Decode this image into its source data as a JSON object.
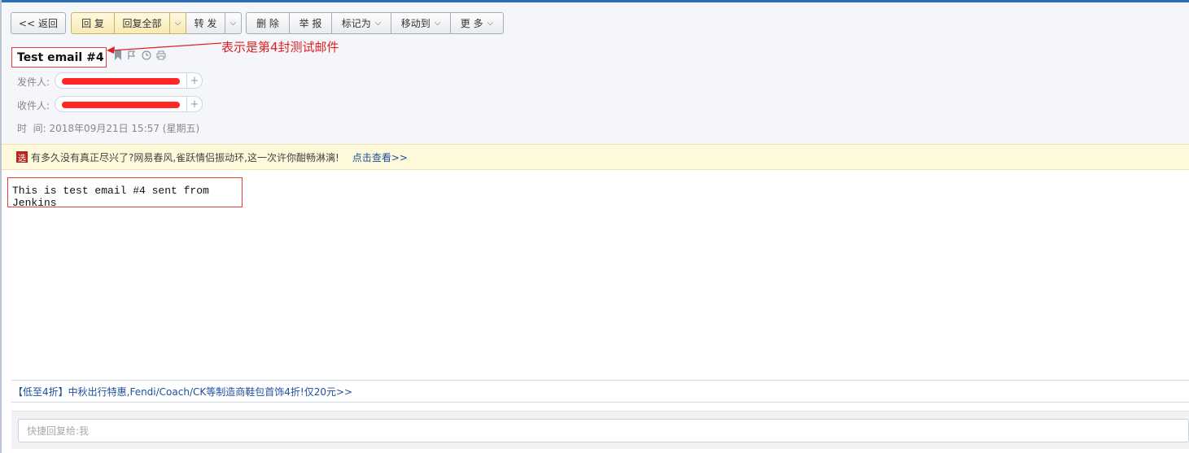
{
  "toolbar": {
    "back": "<< 返回",
    "reply": "回 复",
    "reply_all": "回复全部",
    "forward": "转 发",
    "delete": "删 除",
    "report": "举 报",
    "mark_as": "标记为",
    "move_to": "移动到",
    "more": "更 多"
  },
  "email": {
    "subject": "Test email #4",
    "annotation": "表示是第4封测试邮件",
    "sender_label": "发件人:",
    "recipient_label": "收件人:",
    "time_label": "时  间:",
    "time_value": "2018年09月21日 15:57 (星期五)",
    "body": "This is test email #4 sent from Jenkins"
  },
  "promo": {
    "icon_char": "选",
    "text": "有多久没有真正尽兴了?网易春风,雀跃情侣振动环,这一次许你酣畅淋漓!",
    "link": "点击查看>>"
  },
  "footer_ad": {
    "text": "【低至4折】中秋出行特惠,Fendi/Coach/CK等制造商鞋包首饰4折!仅20元>>"
  },
  "quick_reply": {
    "placeholder": "快捷回复给:我"
  },
  "colors": {
    "annotation_red": "#e02020",
    "link_blue": "#1d4f9a"
  }
}
